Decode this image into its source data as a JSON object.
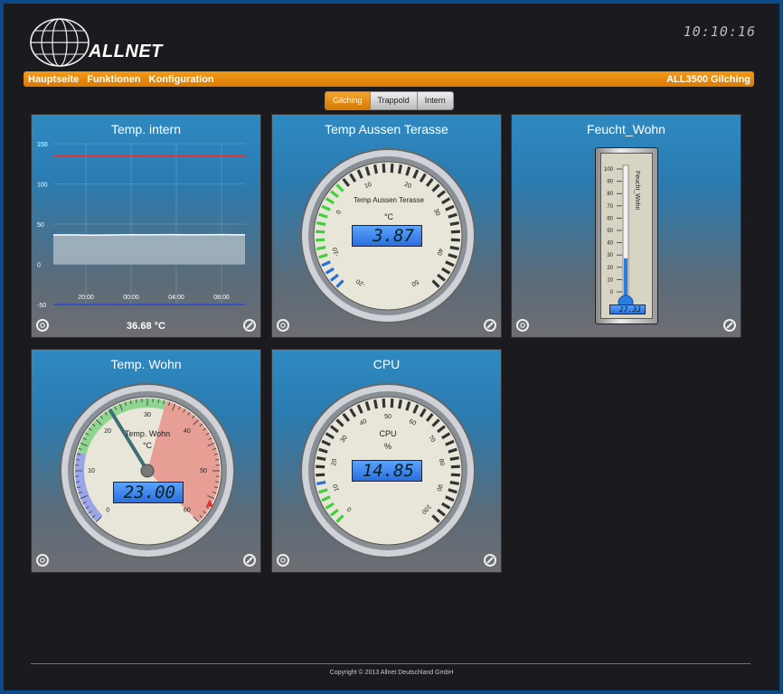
{
  "header": {
    "logo_text": "ALLNET",
    "clock": "10:10:16"
  },
  "nav": {
    "items": [
      "Hauptseite",
      "Funktionen",
      "Konfiguration"
    ],
    "device": "ALL3500 Gilching"
  },
  "tabs": [
    "Gilching",
    "Trappold",
    "Intern"
  ],
  "widgets": {
    "temp_intern": {
      "title": "Temp. intern",
      "value": "36.68 °C",
      "chart_data": {
        "type": "area",
        "y_ticks": [
          "150",
          "100",
          "50",
          "0",
          "-50"
        ],
        "x_ticks": [
          "20:00",
          "00:00",
          "04:00",
          "08:00"
        ],
        "ylim": [
          -50,
          150
        ],
        "series": [
          {
            "values": [
              36.5,
              36.6,
              36.2,
              36.5,
              36.8,
              36.7,
              36.9,
              36.7,
              36.8,
              36.9,
              36.7
            ]
          }
        ],
        "max_line": 135,
        "min_line": -50,
        "colors": {
          "fill": "#a9b8c2",
          "max": "#e03030",
          "min": "#2040e0"
        }
      }
    },
    "temp_aussen": {
      "title": "Temp Aussen Terasse",
      "gauge_label": "Temp Aussen Terasse",
      "unit": "°C",
      "value": "3.87",
      "ticks": [
        "-20",
        "-10",
        "0",
        "10",
        "20",
        "30",
        "40",
        "50"
      ]
    },
    "feucht": {
      "title": "Feucht_Wohn",
      "vertical_label": "Feucht_Wohn",
      "value": "27.33",
      "value_pct": 27.33,
      "ticks": [
        "100",
        "90",
        "80",
        "70",
        "60",
        "50",
        "40",
        "30",
        "20",
        "10",
        "0"
      ]
    },
    "temp_wohn": {
      "title": "Temp. Wohn",
      "gauge_label": "Temp. Wohn",
      "unit": "°C",
      "value": "23.00",
      "ticks": [
        "0",
        "10",
        "20",
        "30",
        "40",
        "50",
        "60"
      ]
    },
    "cpu": {
      "title": "CPU",
      "gauge_label": "CPU",
      "unit": "%",
      "value": "14.85",
      "ticks": [
        "0",
        "10",
        "20",
        "30",
        "40",
        "50",
        "60",
        "70",
        "80",
        "90",
        "100"
      ]
    }
  },
  "footer": {
    "copyright": "Copyright © 2013 Allnet Deutschland GmbH"
  },
  "colors": {
    "accent": "#f08a0a",
    "panel": "#2a7bb0",
    "background": "#1a1a1f"
  }
}
